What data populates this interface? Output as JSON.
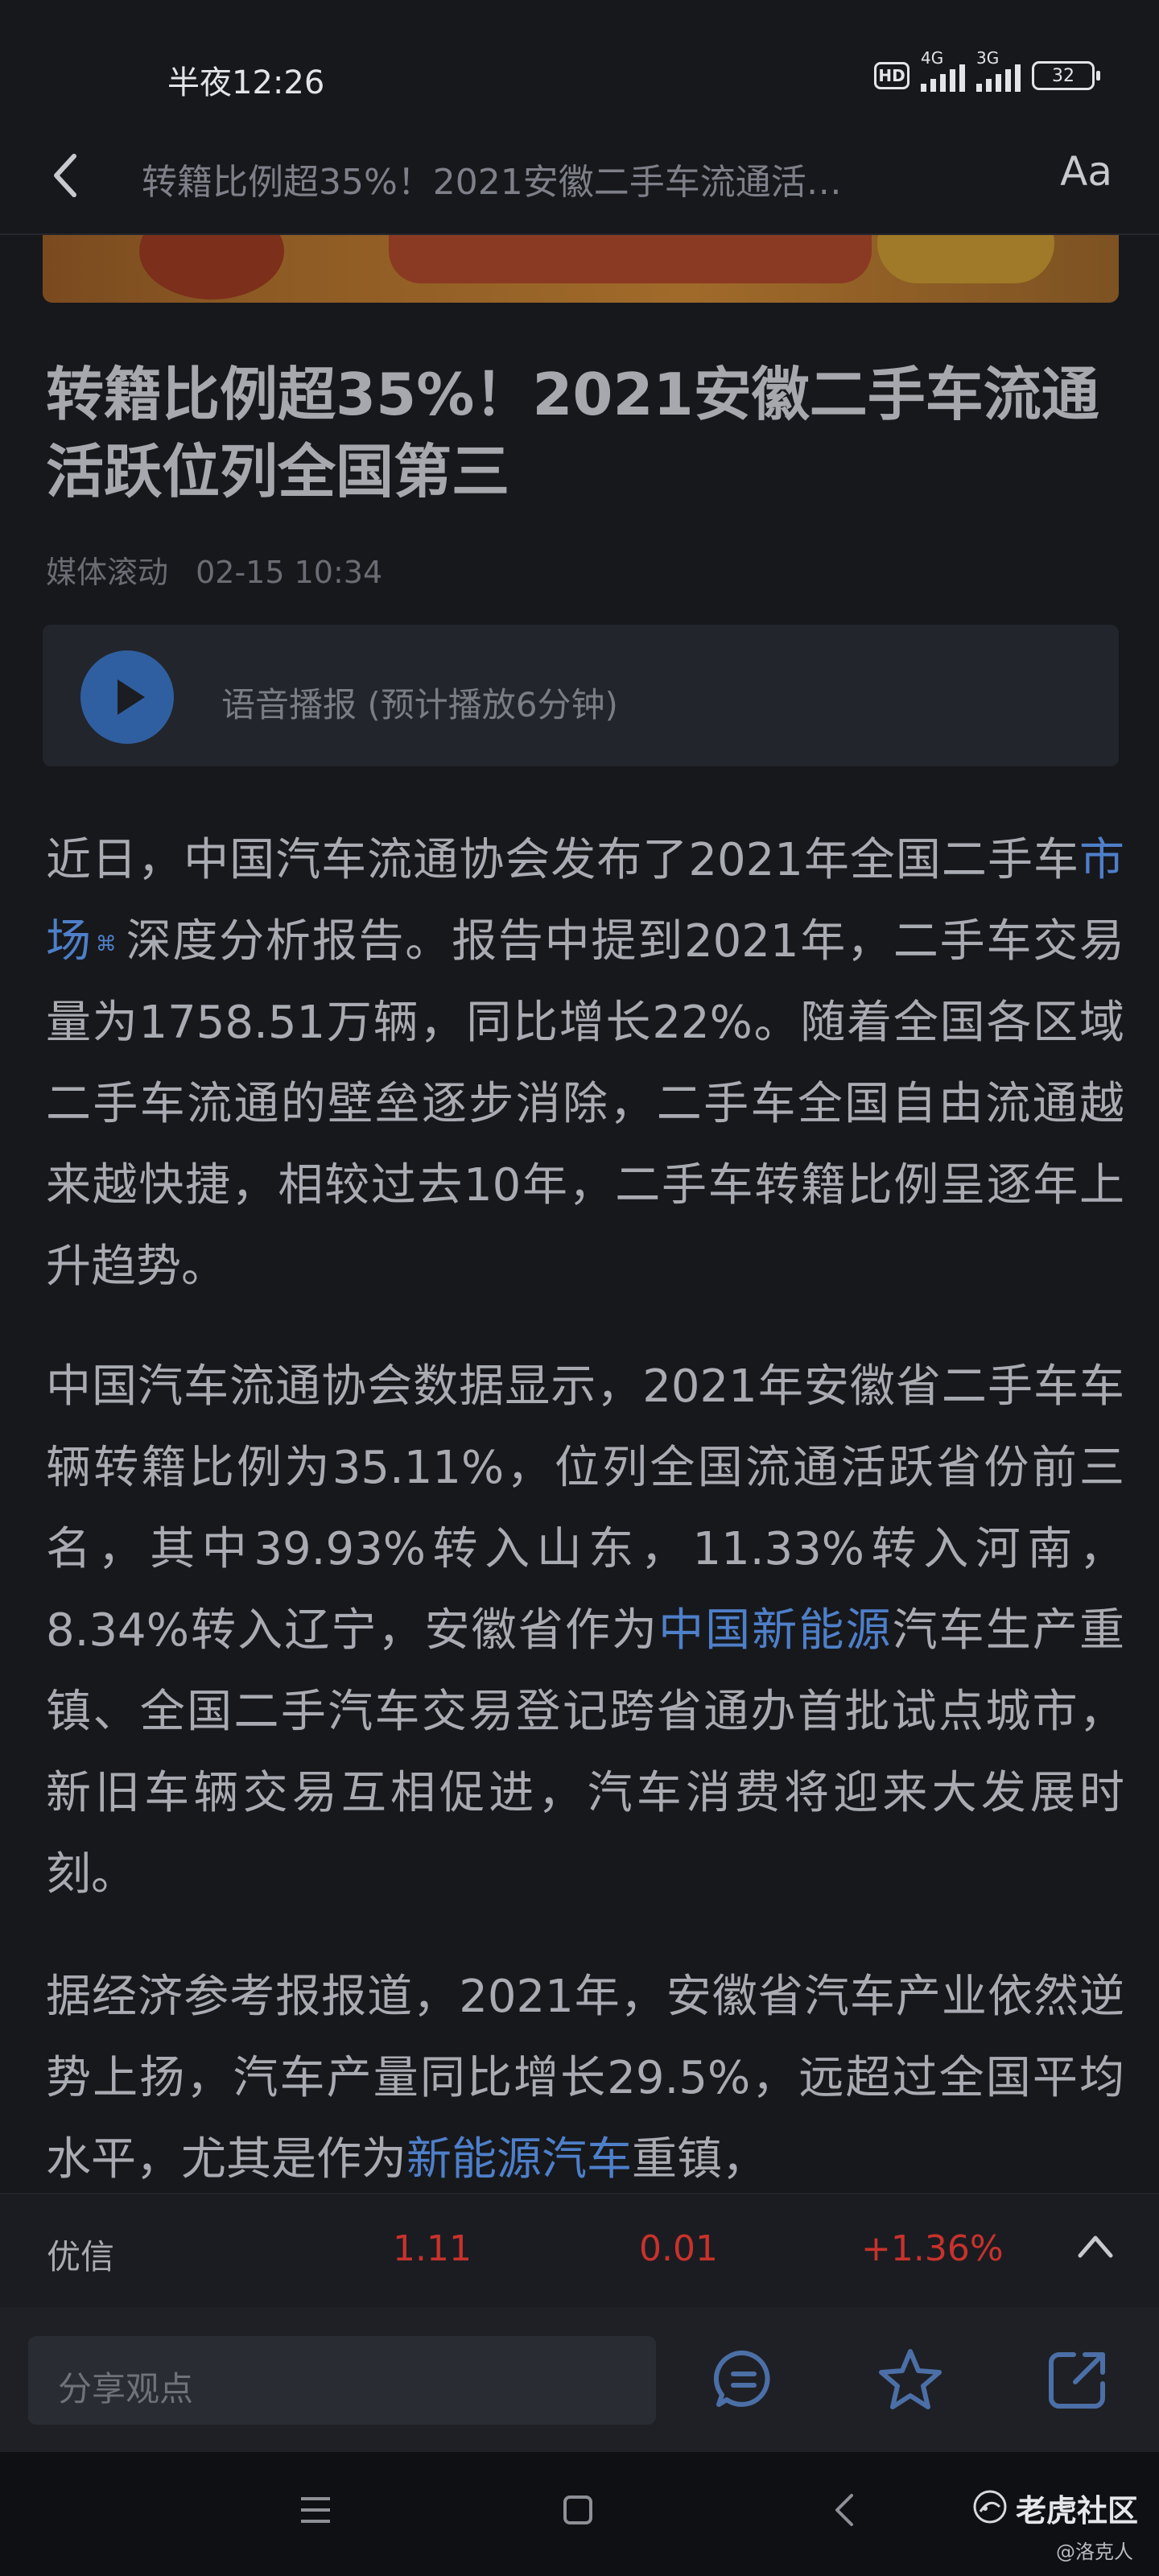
{
  "status_bar": {
    "time": "半夜12:26",
    "hd": "HD",
    "net1": "4G",
    "net2": "3G",
    "battery": "32"
  },
  "nav": {
    "title": "转籍比例超35%！2021安徽二手车流通活…",
    "font_button": "Aa"
  },
  "article": {
    "title": "转籍比例超35%！2021安徽二手车流通活跃位列全国第三",
    "source": "媒体滚动",
    "date": "02-15 10:34",
    "audio_label": "语音播报 (预计播放6分钟)",
    "p1": {
      "a": "近日，中国汽车流通协会发布了2021年全国二手车",
      "link": "市场",
      "b": "深度分析报告。报告中提到2021年，二手车交易量为1758.51万辆，同比增长22%。随着全国各区域二手车流通的壁垒逐步消除，二手车全国自由流通越来越快捷，相较过去10年，二手车转籍比例呈逐年上升趋势。"
    },
    "p2": {
      "a": "中国汽车流通协会数据显示，2021年安徽省二手车车辆转籍比例为35.11%，位列全国流通活跃省份前三名，其中39.93%转入山东，11.33%转入河南，8.34%转入辽宁，安徽省作为",
      "link": "中国新能源",
      "b": "汽车生产重镇、全国二手汽车交易登记跨省通办首批试点城市，新旧车辆交易互相促进，汽车消费将迎来大发展时刻。"
    },
    "p3": {
      "a": "据经济参考报报道，2021年，安徽省汽车产业依然逆势上扬，汽车产量同比增长29.5%，远超过全国平均水平，尤其是作为",
      "link": "新能源汽车",
      "b": "重镇，"
    }
  },
  "stock": {
    "name": "优信",
    "price": "1.11",
    "change": "0.01",
    "pct": "+1.36%"
  },
  "comment_bar": {
    "placeholder": "分享观点"
  },
  "footer": {
    "community": "老虎社区",
    "watermark": "@洛克人"
  },
  "colors": {
    "background": "#17181c",
    "link": "#4e7fc9",
    "stock_up": "#c8322c",
    "play_button": "#2f5fa0"
  }
}
